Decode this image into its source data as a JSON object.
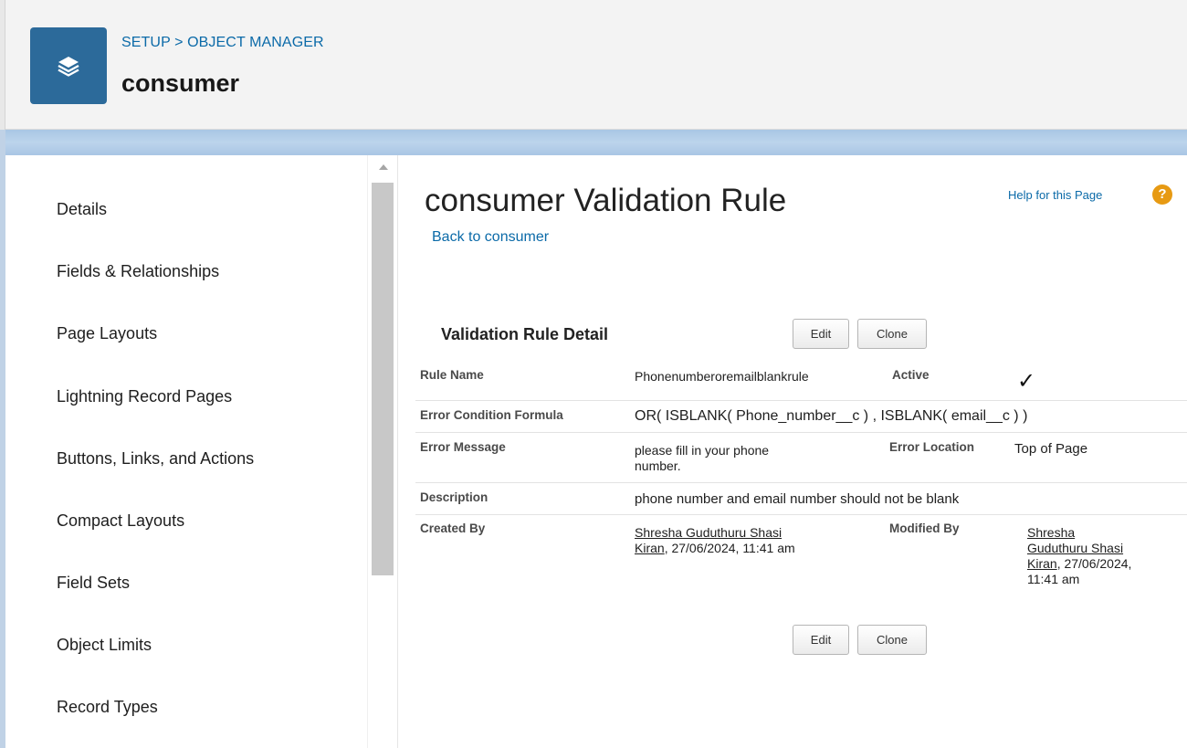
{
  "header": {
    "breadcrumb_setup": "SETUP",
    "breadcrumb_sep": ">",
    "breadcrumb_object_manager": "OBJECT MANAGER",
    "object_name": "consumer",
    "icon": "layers-icon"
  },
  "sidebar": {
    "items": [
      {
        "label": "Details"
      },
      {
        "label": "Fields & Relationships"
      },
      {
        "label": "Page Layouts"
      },
      {
        "label": "Lightning Record Pages"
      },
      {
        "label": "Buttons, Links, and Actions"
      },
      {
        "label": "Compact Layouts"
      },
      {
        "label": "Field Sets"
      },
      {
        "label": "Object Limits"
      },
      {
        "label": "Record Types"
      }
    ]
  },
  "main": {
    "title": "consumer Validation Rule",
    "back_link": "Back to consumer",
    "help_link": "Help for this Page",
    "help_icon": "?",
    "section_title": "Validation Rule Detail",
    "edit_label": "Edit",
    "clone_label": "Clone",
    "fields": {
      "rule_name_label": "Rule Name",
      "rule_name_value": "Phonenumberoremailblankrule",
      "active_label": "Active",
      "active_value": "✓",
      "formula_label": "Error Condition Formula",
      "formula_value": "OR( ISBLANK( Phone_number__c ) , ISBLANK( email__c ) )",
      "error_message_label": "Error Message",
      "error_message_line1": "please fill in your phone",
      "error_message_line2": "number.",
      "error_location_label": "Error Location",
      "error_location_value": "Top of Page",
      "description_label": "Description",
      "description_value": "phone number and email number should not be blank",
      "created_by_label": "Created By",
      "created_by_user_line1": "Shresha Guduthuru Shasi",
      "created_by_user_line2": "Kiran",
      "created_by_date": ", 27/06/2024, 11:41 am",
      "modified_by_label": "Modified By",
      "modified_by_user_line1": "Shresha",
      "modified_by_user_line2": "Guduthuru Shasi",
      "modified_by_user_line3": "Kiran",
      "modified_by_date_line3": ", 27/06/2024,",
      "modified_by_date_line4": "11:41 am"
    }
  },
  "colors": {
    "link": "#0b6aa8",
    "icon_bg": "#2c6a9a",
    "help_icon": "#e79a13",
    "band": "#a9c6e4"
  }
}
